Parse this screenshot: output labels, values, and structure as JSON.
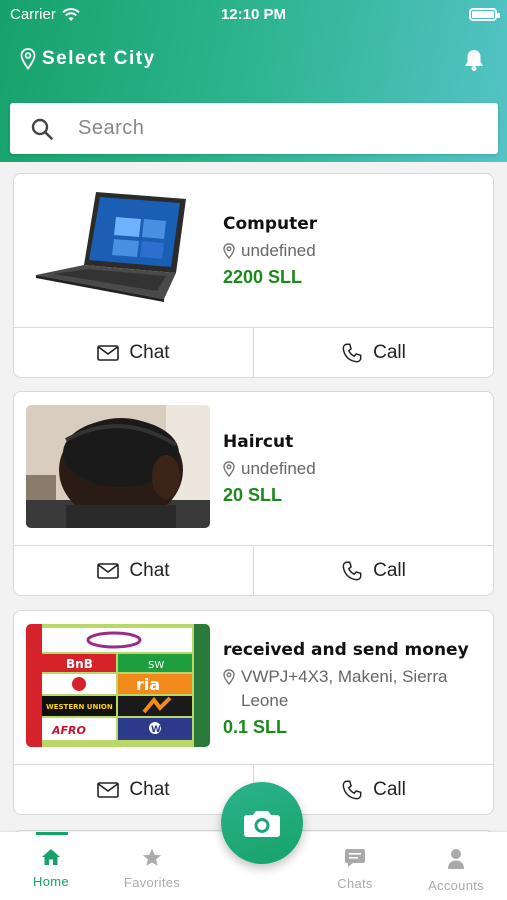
{
  "status": {
    "carrier": "Carrier",
    "time": "12:10 PM"
  },
  "header": {
    "city_label": "Select City"
  },
  "search": {
    "placeholder": "Search"
  },
  "colors": {
    "accent": "#17a26a",
    "price": "#1a8a1a",
    "header_gradient_end": "#54c3c6"
  },
  "listings": [
    {
      "title": "Computer",
      "location": "undefined",
      "price": "2200 SLL",
      "image": "laptop",
      "chat_label": "Chat",
      "call_label": "Call"
    },
    {
      "title": "Haircut",
      "location": "undefined",
      "price": "20 SLL",
      "image": "haircut-photo",
      "chat_label": "Chat",
      "call_label": "Call"
    },
    {
      "title": "received and send money",
      "location": "VWPJ+4X3, Makeni, Sierra Leone",
      "price": "0.1 SLL",
      "image": "money-transfer-logos",
      "chat_label": "Chat",
      "call_label": "Call"
    }
  ],
  "logos": {
    "brand1": "BnB",
    "brand2": "SW",
    "brand3": "ria",
    "brand4": "WESTERN UNION",
    "brand5": "AFRO",
    "brand6": "W"
  },
  "tabs": [
    {
      "label": "Home",
      "icon": "home-icon",
      "active": true
    },
    {
      "label": "Favorites",
      "icon": "star-icon",
      "active": false
    },
    {
      "label": "Chats",
      "icon": "chat-bubble-icon",
      "active": false
    },
    {
      "label": "Accounts",
      "icon": "person-icon",
      "active": false
    }
  ],
  "fab": {
    "icon": "camera-icon"
  }
}
